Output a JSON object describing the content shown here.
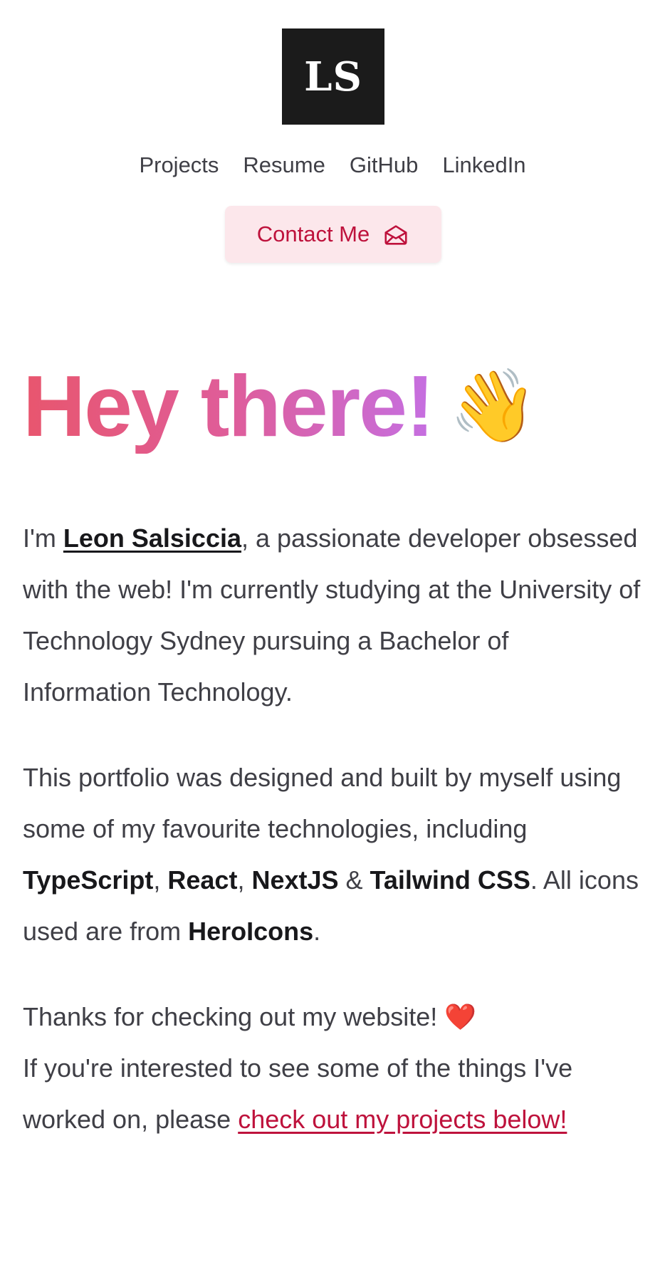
{
  "header": {
    "logo_text": "LS",
    "nav": [
      {
        "label": "Projects"
      },
      {
        "label": "Resume"
      },
      {
        "label": "GitHub"
      },
      {
        "label": "LinkedIn"
      }
    ],
    "contact_button": {
      "label": "Contact Me",
      "icon": "envelope-open-icon"
    }
  },
  "hero": {
    "title": "Hey there!",
    "emoji": "👋"
  },
  "intro": {
    "p1_prefix": "I'm ",
    "name": "Leon Salsiccia",
    "p1_rest": ", a passionate developer obsessed with the web! I'm currently studying at the University of Technology Sydney pursuing a Bachelor of Information Technology.",
    "p2_part1": "This portfolio was designed and built by myself using some of my favourite technologies, including ",
    "tech": [
      "TypeScript",
      "React",
      "NextJS",
      "Tailwind CSS"
    ],
    "sep_comma": ", ",
    "sep_amp": " & ",
    "p2_part2": ". All icons used are from ",
    "icons_source": "HeroIcons",
    "p2_end": ".",
    "p3_line1": "Thanks for checking out my website! ",
    "heart": "❤️",
    "p3_line2": "If you're interested to see some of the things I've worked on, please ",
    "projects_link": "check out my projects below!"
  },
  "colors": {
    "logo_bg": "#1b1b1b",
    "accent": "#be123c",
    "contact_bg": "#fce7eb",
    "text": "#3f3f46",
    "strong_text": "#18181b",
    "gradient_start": "#e8566e",
    "gradient_mid": "#df5d99",
    "gradient_end": "#c56fe2"
  }
}
